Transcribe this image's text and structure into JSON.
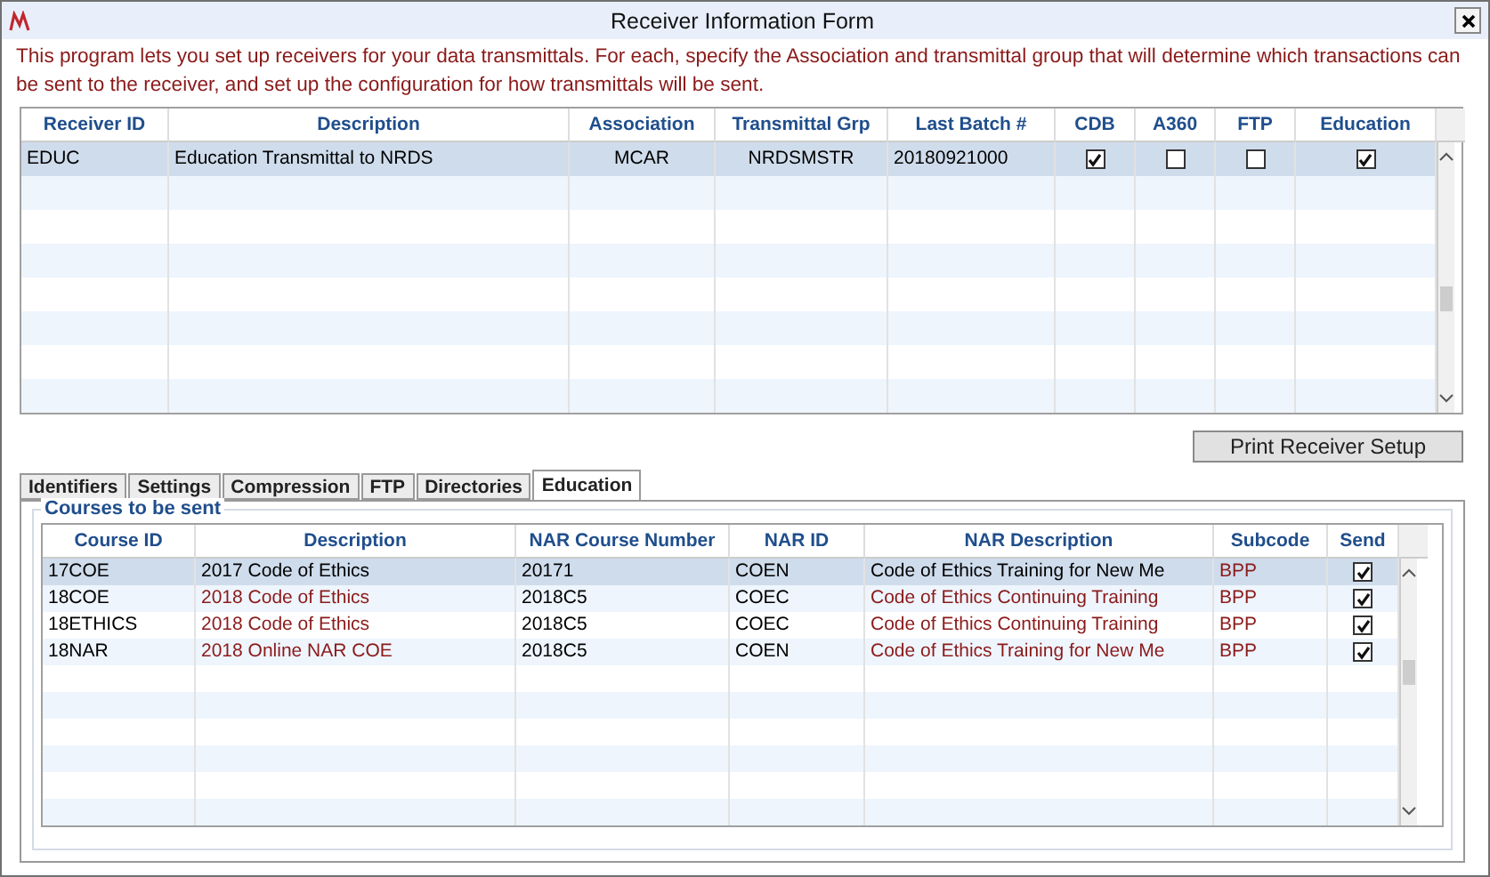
{
  "window": {
    "title": "Receiver Information Form"
  },
  "intro": "This program lets you set up receivers for your data transmittals. For each, specify the Association and transmittal group that will determine which transactions can be sent to the receiver, and set up the configuration for how transmittals will be sent.",
  "receivers": {
    "columns": [
      "Receiver ID",
      "Description",
      "Association",
      "Transmittal Grp",
      "Last Batch #",
      "CDB",
      "A360",
      "FTP",
      "Education"
    ],
    "rows": [
      {
        "receiver_id": "EDUC",
        "description": "Education Transmittal to NRDS",
        "association": "MCAR",
        "transmittal_grp": "NRDSMSTR",
        "last_batch": "20180921000",
        "cdb": true,
        "a360": false,
        "ftp": false,
        "education": true,
        "selected": true
      }
    ]
  },
  "print_button": "Print Receiver Setup",
  "tabs": [
    {
      "label": "Identifiers",
      "selected": false
    },
    {
      "label": "Settings",
      "selected": false
    },
    {
      "label": "Compression",
      "selected": false
    },
    {
      "label": "FTP",
      "selected": false
    },
    {
      "label": "Directories",
      "selected": false
    },
    {
      "label": "Education",
      "selected": true
    }
  ],
  "courses": {
    "group_title": "Courses to be sent",
    "columns": [
      "Course ID",
      "Description",
      "NAR Course Number",
      "NAR ID",
      "NAR Description",
      "Subcode",
      "Send"
    ],
    "rows": [
      {
        "course_id": "17COE",
        "description": "2017 Code of Ethics",
        "nar_course_number": "20171",
        "nar_id": "COEN",
        "nar_description": "Code of Ethics Training for New Me",
        "subcode": "BPP",
        "send": true,
        "selected": true,
        "color": "#000000"
      },
      {
        "course_id": "18COE",
        "description": "2018 Code of Ethics",
        "nar_course_number": "2018C5",
        "nar_id": "COEC",
        "nar_description": "Code of Ethics Continuing Training",
        "subcode": "BPP",
        "send": true,
        "selected": false,
        "color": "#8b1a1a"
      },
      {
        "course_id": "18ETHICS",
        "description": "2018 Code of Ethics",
        "nar_course_number": "2018C5",
        "nar_id": "COEC",
        "nar_description": "Code of Ethics Continuing Training",
        "subcode": "BPP",
        "send": true,
        "selected": false,
        "color": "#8b1a1a"
      },
      {
        "course_id": "18NAR",
        "description": "2018 Online NAR COE",
        "nar_course_number": "2018C5",
        "nar_id": "COEN",
        "nar_description": "Code of Ethics Training for New Me",
        "subcode": "BPP",
        "send": true,
        "selected": false,
        "color": "#8b1a1a"
      }
    ]
  }
}
